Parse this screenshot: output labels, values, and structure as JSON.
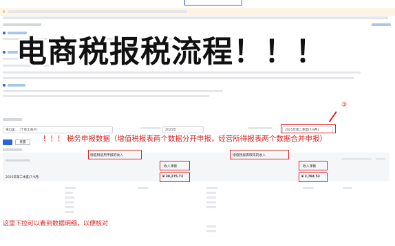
{
  "overlay": {
    "title": "电商税报税流程！！！",
    "annotation_main": "！！！ 税务申报数据（增值税报表两个数据分开申报，经营所得报表两个数据合并申报）",
    "annotation_bottom": "这里下拉可以看到数据明细，以便核对",
    "annotation_number": "③"
  },
  "filters": {
    "field_1_value": "海口美...（个体工商户）",
    "field_2_value": "2025年",
    "field_3_value": "2025年第二季度(7-9月)"
  },
  "toolbar": {
    "reset_label": "重置"
  },
  "table": {
    "highlighted_headers": [
      "增值税适用申报的收入",
      "收入净额",
      "增值税报表取得的收入",
      "收入净额"
    ],
    "period_label": "2025年第二季度(7-9月)",
    "summary_amounts": [
      "¥ 38,275.73",
      "¥ 2,784.53"
    ]
  }
}
